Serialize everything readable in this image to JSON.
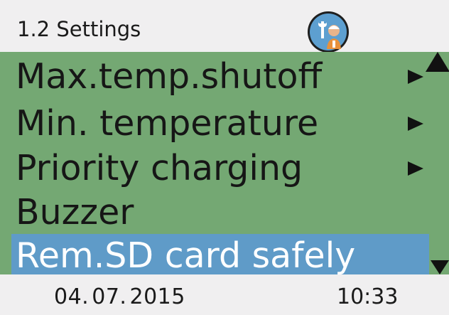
{
  "header": {
    "title": "1.2 Settings",
    "icon": "service-technician-icon"
  },
  "menu": {
    "items": [
      {
        "label": "Max.temp.shutoff",
        "has_submenu": true,
        "selected": false
      },
      {
        "label": "Min. temperature",
        "has_submenu": true,
        "selected": false
      },
      {
        "label": "Priority charging",
        "has_submenu": true,
        "selected": false
      },
      {
        "label": "Buzzer",
        "has_submenu": false,
        "selected": false
      },
      {
        "label": "Rem.SD card safely",
        "has_submenu": false,
        "selected": true
      }
    ],
    "scroll_up_icon": "scroll-up-icon",
    "scroll_down_icon": "scroll-down-icon"
  },
  "footer": {
    "date": "04. 07. 2015",
    "time": "10:33"
  },
  "colors": {
    "menu_background": "#74a873",
    "selection_background": "#5f9bc8",
    "bar_background": "#f0eff0",
    "icon_background": "#5d9fd0"
  }
}
